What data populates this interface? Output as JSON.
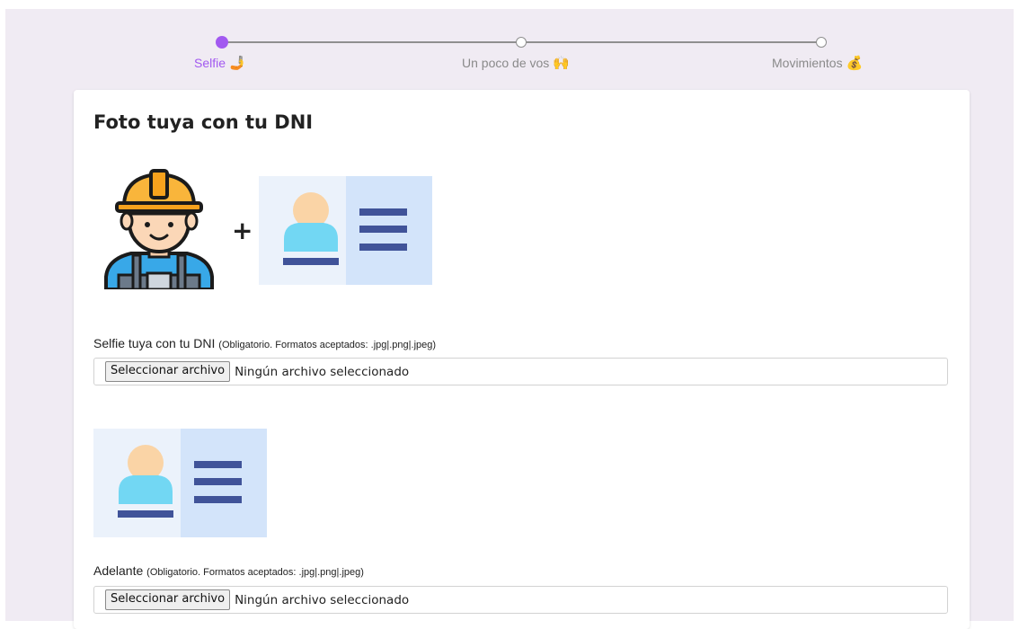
{
  "stepper": {
    "steps": [
      {
        "label": "Selfie",
        "emoji": "🤳",
        "state": "active"
      },
      {
        "label": "Un poco de vos",
        "emoji": "🙌",
        "state": "pending"
      },
      {
        "label": "Movimientos",
        "emoji": "💰",
        "state": "pending"
      }
    ],
    "active_color": "#a259f0"
  },
  "form": {
    "title": "Foto tuya con tu DNI",
    "plus_symbol": "+",
    "fields": [
      {
        "label": "Selfie tuya con tu DNI",
        "hint": "(Obligatorio. Formatos aceptados: .jpg|.png|.jpeg)",
        "button_label": "Seleccionar archivo",
        "status": "Ningún archivo seleccionado"
      },
      {
        "label": "Adelante",
        "hint": "(Obligatorio. Formatos aceptados: .jpg|.png|.jpeg)",
        "button_label": "Seleccionar archivo",
        "status": "Ningún archivo seleccionado"
      }
    ]
  }
}
